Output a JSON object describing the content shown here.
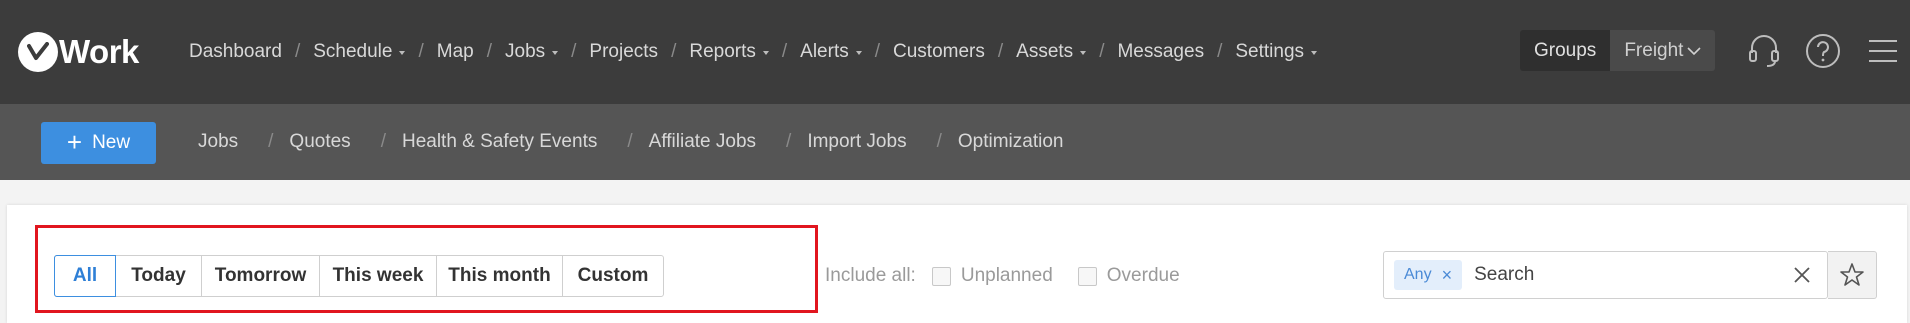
{
  "brand": {
    "name": "Work",
    "logo_icon": "v-check-logo"
  },
  "mainnav": {
    "items": [
      {
        "label": "Dashboard",
        "dropdown": false
      },
      {
        "label": "Schedule",
        "dropdown": true
      },
      {
        "label": "Map",
        "dropdown": false
      },
      {
        "label": "Jobs",
        "dropdown": true
      },
      {
        "label": "Projects",
        "dropdown": false
      },
      {
        "label": "Reports",
        "dropdown": true
      },
      {
        "label": "Alerts",
        "dropdown": true
      },
      {
        "label": "Customers",
        "dropdown": false
      },
      {
        "label": "Assets",
        "dropdown": true
      },
      {
        "label": "Messages",
        "dropdown": false
      },
      {
        "label": "Settings",
        "dropdown": true
      }
    ],
    "separator": "/"
  },
  "group_toggle": {
    "groups_label": "Groups",
    "freight_label": "Freight"
  },
  "top_icons": [
    "headset-icon",
    "help-icon",
    "menu-icon"
  ],
  "subnav": {
    "new_button": {
      "plus": "+",
      "label": "New"
    },
    "items": [
      "Jobs",
      "Quotes",
      "Health & Safety Events",
      "Affiliate Jobs",
      "Import Jobs",
      "Optimization"
    ],
    "separator": "/"
  },
  "filter": {
    "segments": [
      "All",
      "Today",
      "Tomorrow",
      "This week",
      "This month",
      "Custom"
    ],
    "active_segment": "All",
    "include_all_label": "Include all:",
    "unplanned_label": "Unplanned",
    "overdue_label": "Overdue"
  },
  "search": {
    "chip_label": "Any",
    "chip_remove": "×",
    "placeholder": "Search"
  },
  "colors": {
    "topbar": "#3c3c3c",
    "subbar": "#555555",
    "accent": "#3d8fe0",
    "highlight": "#e1161f"
  }
}
